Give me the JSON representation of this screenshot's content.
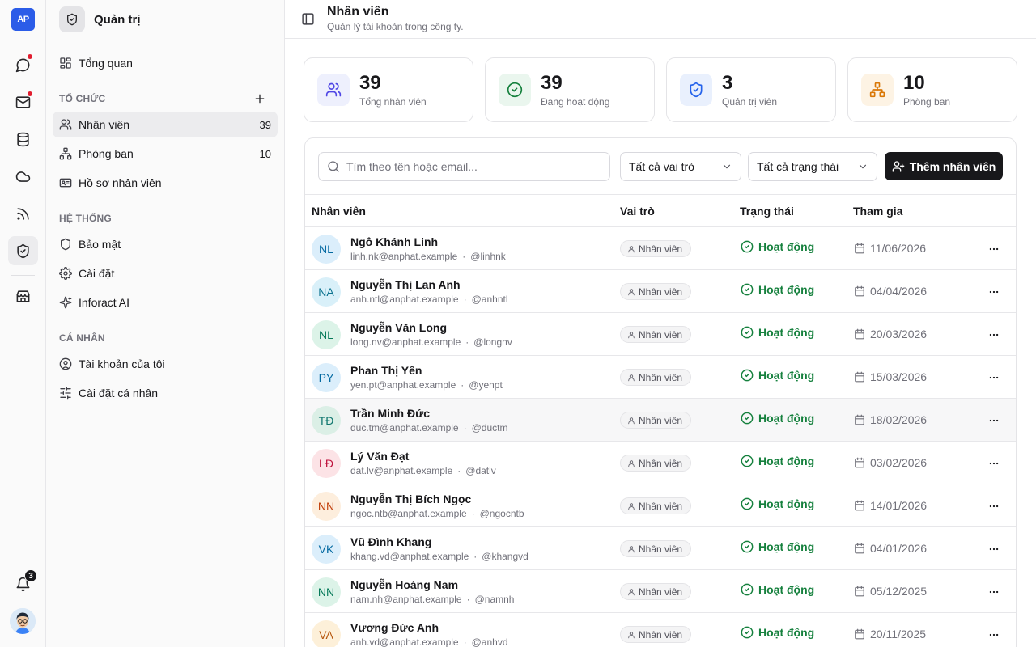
{
  "rail": {
    "logo": "AP",
    "notifications_count": "3",
    "icons": [
      "message-icon",
      "mail-icon",
      "database-icon",
      "cloud-icon",
      "rss-icon",
      "shield-icon",
      "store-icon",
      "bell-icon"
    ]
  },
  "sidebar": {
    "title": "Quản trị",
    "overview": "Tổng quan",
    "sections": {
      "org": "TỔ CHỨC",
      "system": "HỆ THỐNG",
      "personal": "CÁ NHÂN"
    },
    "org_items": [
      {
        "label": "Nhân viên",
        "count": "39"
      },
      {
        "label": "Phòng ban",
        "count": "10"
      },
      {
        "label": "Hồ sơ nhân viên",
        "count": ""
      }
    ],
    "system_items": [
      {
        "label": "Bảo mật"
      },
      {
        "label": "Cài đặt"
      },
      {
        "label": "Inforact AI"
      }
    ],
    "personal_items": [
      {
        "label": "Tài khoản của tôi"
      },
      {
        "label": "Cài đặt cá nhân"
      }
    ]
  },
  "header": {
    "title": "Nhân viên",
    "subtitle": "Quản lý tài khoản trong công ty."
  },
  "stats": [
    {
      "value": "39",
      "label": "Tổng nhân viên",
      "color": "#4f46e5",
      "bg": "#eef0fd"
    },
    {
      "value": "39",
      "label": "Đang hoạt động",
      "color": "#15803d",
      "bg": "#eaf6ee"
    },
    {
      "value": "3",
      "label": "Quản trị viên",
      "color": "#2563eb",
      "bg": "#e9f0fd"
    },
    {
      "value": "10",
      "label": "Phòng ban",
      "color": "#d97706",
      "bg": "#fdf3e4"
    }
  ],
  "toolbar": {
    "search_placeholder": "Tìm theo tên hoặc email...",
    "role_filter": "Tất cả vai trò",
    "status_filter": "Tất cả trạng thái",
    "add_label": "Thêm nhân viên"
  },
  "table": {
    "headers": [
      "Nhân viên",
      "Vai trò",
      "Trạng thái",
      "Tham gia"
    ],
    "rows": [
      {
        "initials": "NL",
        "name": "Ngô Khánh Linh",
        "email": "linh.nk@anphat.example",
        "handle": "@linhnk",
        "role": "Nhân viên",
        "status": "Hoạt động",
        "joined": "11/06/2026",
        "avatar_bg": "#dbeefb",
        "avatar_fg": "#0369a1"
      },
      {
        "initials": "NA",
        "name": "Nguyễn Thị Lan Anh",
        "email": "anh.ntl@anphat.example",
        "handle": "@anhntl",
        "role": "Nhân viên",
        "status": "Hoạt động",
        "joined": "04/04/2026",
        "avatar_bg": "#d9f0f9",
        "avatar_fg": "#0e7490"
      },
      {
        "initials": "NL",
        "name": "Nguyễn Văn Long",
        "email": "long.nv@anphat.example",
        "handle": "@longnv",
        "role": "Nhân viên",
        "status": "Hoạt động",
        "joined": "20/03/2026",
        "avatar_bg": "#dcf3e8",
        "avatar_fg": "#047857"
      },
      {
        "initials": "PY",
        "name": "Phan Thị Yến",
        "email": "yen.pt@anphat.example",
        "handle": "@yenpt",
        "role": "Nhân viên",
        "status": "Hoạt động",
        "joined": "15/03/2026",
        "avatar_bg": "#dbeefb",
        "avatar_fg": "#0369a1"
      },
      {
        "initials": "TĐ",
        "name": "Trần Minh Đức",
        "email": "duc.tm@anphat.example",
        "handle": "@ductm",
        "role": "Nhân viên",
        "status": "Hoạt động",
        "joined": "18/02/2026",
        "avatar_bg": "#dbefe6",
        "avatar_fg": "#0f766e"
      },
      {
        "initials": "LĐ",
        "name": "Lý Văn Đạt",
        "email": "dat.lv@anphat.example",
        "handle": "@datlv",
        "role": "Nhân viên",
        "status": "Hoạt động",
        "joined": "03/02/2026",
        "avatar_bg": "#fce3e6",
        "avatar_fg": "#be123c"
      },
      {
        "initials": "NN",
        "name": "Nguyễn Thị Bích Ngọc",
        "email": "ngoc.ntb@anphat.example",
        "handle": "@ngocntb",
        "role": "Nhân viên",
        "status": "Hoạt động",
        "joined": "14/01/2026",
        "avatar_bg": "#fdeedd",
        "avatar_fg": "#c2410c"
      },
      {
        "initials": "VK",
        "name": "Vũ Đình Khang",
        "email": "khang.vd@anphat.example",
        "handle": "@khangvd",
        "role": "Nhân viên",
        "status": "Hoạt động",
        "joined": "04/01/2026",
        "avatar_bg": "#dbeefb",
        "avatar_fg": "#0369a1"
      },
      {
        "initials": "NN",
        "name": "Nguyễn Hoàng Nam",
        "email": "nam.nh@anphat.example",
        "handle": "@namnh",
        "role": "Nhân viên",
        "status": "Hoạt động",
        "joined": "05/12/2025",
        "avatar_bg": "#dcf3e8",
        "avatar_fg": "#047857"
      },
      {
        "initials": "VA",
        "name": "Vương Đức Anh",
        "email": "anh.vd@anphat.example",
        "handle": "@anhvd",
        "role": "Nhân viên",
        "status": "Hoạt động",
        "joined": "20/11/2025",
        "avatar_bg": "#fdf0d9",
        "avatar_fg": "#b45309"
      }
    ]
  }
}
